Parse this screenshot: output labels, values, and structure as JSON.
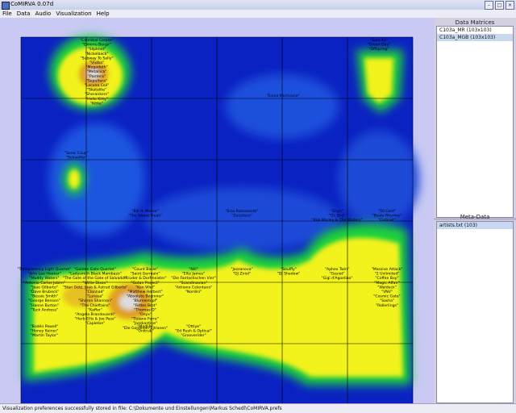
{
  "window": {
    "title": "CoMIRVA 0.07d"
  },
  "menu": [
    "File",
    "Data",
    "Audio",
    "Visualization",
    "Help"
  ],
  "data_matrices": {
    "title": "Data Matrices",
    "items": [
      {
        "label": "C103a_MR (103x103)",
        "selected": false
      },
      {
        "label": "C103a_MGB (103x103)",
        "selected": true
      }
    ]
  },
  "meta_data": {
    "title": "Meta-Data",
    "items": [
      {
        "label": "artists.txt (103)",
        "selected": true
      }
    ]
  },
  "status": "Visualization preferences successfully stored in file: C:\\Dokumente und Einstellungen\\Markus Schedl\\CoMIRVA.prefs",
  "labels": [
    {
      "lines": [
        "\"Cannibal Corpse\"",
        "\"Dimmu Borgir\"",
        "\"Slipknot\"",
        "\"Nickelback\"",
        "\"Subway To Sally\"",
        "\"Vixiba\"",
        "\"Megadeth\"",
        "\"Metallica\"",
        "\"Pantera\"",
        "\"Sepultura\"",
        "\"Lacuna Coil\"",
        "\"Skatalite\"",
        "\"Sherankers\"",
        "\"Hello Kitty\"",
        "\"Kittie\""
      ]
    },
    {
      "lines": [
        "\"Sum 41\"",
        "\"Green Day\"",
        "\"Offspring\""
      ]
    },
    {
      "lines": [
        "\"Ennio Morricone\""
      ]
    },
    {
      "lines": [
        "\"Sonic Coup\"",
        "\"Schaeffer\""
      ]
    },
    {
      "lines": [
        "\"Bill H. Moore\"",
        "\"The Sweet Freak\""
      ]
    },
    {
      "lines": [
        "\"Eros Ramazzotti\"",
        "\"Zucchero\""
      ]
    },
    {
      "lines": [
        "\"Enya\"",
        "\"Dr. Dre\"",
        "\"Bob Marley & The Wailers\""
      ]
    },
    {
      "lines": [
        "\"50 Cent\"",
        "\"Busta Rhymes\"",
        "\"Outkast\""
      ]
    },
    {
      "lines": [
        "\"Transparency Light Quartet\"",
        "\"John Lee Hooker\"",
        "\"Muddy Waters\"",
        "\"Antonio Carlos Jobim\"",
        "\"Joao Gilberto\"",
        "\"Dave Brubeck\"",
        "\"Bessie Smith\"",
        "\"George Benson\"",
        "\"Hanne Burton\"",
        "\"Tuck Andress\""
      ]
    },
    {
      "lines": [
        "\"Golden Gate Quartet\"",
        "\"Ladysmith Black Mambazo\"",
        "\"The Gate of the Gate of Salvador\"",
        "\"Willie Dixon\"",
        "\"Stan Getz, Joao & Astrud Gilberto\"",
        "\"Clannad\"",
        "\"Lunasa\"",
        "\"Sharon Shannon\"",
        "\"The Chieftains\"",
        "\"Kaffer\"",
        "\"Angela Brandouardi\"",
        "\"Herb Ellis & Joe Pass\"",
        "\"Capleton\""
      ]
    },
    {
      "lines": [
        "\"Count Basie\"",
        "\"Saint Germain\"",
        "\"Kruder & Dorfmeister\"",
        "\"Gotan Project\"",
        "\"Ken Wiel\"",
        "\"Matthew Herbert\"",
        "\"Absolute Beginner\"",
        "\"Blumentopf\"",
        "\"Fettes Brot\"",
        "\"Thomas D\"",
        "\"Onyx\"",
        "\"Tiziano Ferro\"",
        "\"Jazzkantine\"",
        "\"Die Goldenen Zitronen\""
      ]
    },
    {
      "lines": [
        "\"Nill\"",
        "\"Elliz James\"",
        "\"Die Fantastischen Vier\"",
        "\"Scandinavian\"",
        "\"Adriano Celentano\"",
        "\"Nordini\""
      ]
    },
    {
      "lines": [
        "\"Jazzanova\"",
        "\"DJ Ziriol\""
      ]
    },
    {
      "lines": [
        "\"Soulfly\"",
        "\"DJ Shadow\""
      ]
    },
    {
      "lines": [
        "\"Aphex Twin\"",
        "\"Gesiot\"",
        "\"Gigi d'Agostino\""
      ]
    },
    {
      "lines": [
        "\"Massive Attack\"",
        "\"2 Unlimited\"",
        "\"Coffee Boy\"",
        "\"Magic Affair\"",
        "\"Waldeck\"",
        "\"VNV\"",
        "\"Cosmic Gate\"",
        "\"Sasha\"",
        "\"Rollerlings\""
      ]
    },
    {
      "lines": [
        "\"Bodén Powell\"",
        "\"Honey Keiner\"",
        "\"Martin Taylor\""
      ]
    },
    {
      "lines": [
        "\"Madlib\"",
        "\"Onitrub\""
      ]
    },
    {
      "lines": [
        "\"Ottiye\"",
        "\"Ed Rush & Optical\"",
        "\"Grooverider\""
      ]
    }
  ]
}
